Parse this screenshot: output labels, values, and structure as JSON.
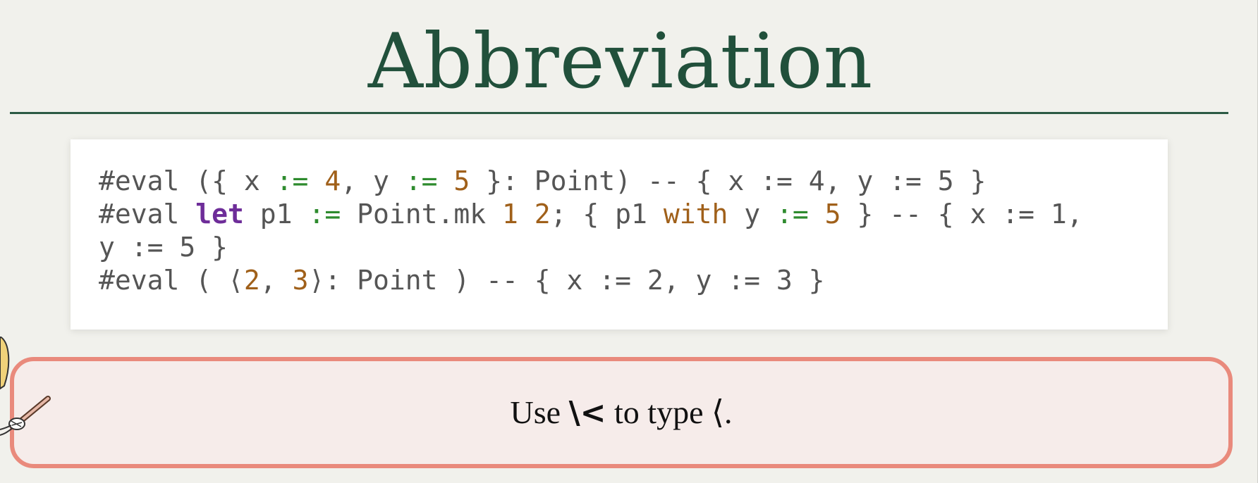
{
  "title": "Abbreviation",
  "code_block": {
    "lines": [
      [
        {
          "t": "#eval ({ x ",
          "c": "plain"
        },
        {
          "t": ":=",
          "c": "op"
        },
        {
          "t": " ",
          "c": "plain"
        },
        {
          "t": "4",
          "c": "num"
        },
        {
          "t": ", y ",
          "c": "plain"
        },
        {
          "t": ":=",
          "c": "op"
        },
        {
          "t": " ",
          "c": "plain"
        },
        {
          "t": "5",
          "c": "num"
        },
        {
          "t": " }: Point) -- { x := 4, y := 5 }",
          "c": "plain"
        }
      ],
      [
        {
          "t": "#eval ",
          "c": "plain"
        },
        {
          "t": "let",
          "c": "kw"
        },
        {
          "t": " p1 ",
          "c": "plain"
        },
        {
          "t": ":=",
          "c": "op"
        },
        {
          "t": " Point.mk ",
          "c": "plain"
        },
        {
          "t": "1",
          "c": "num"
        },
        {
          "t": " ",
          "c": "plain"
        },
        {
          "t": "2",
          "c": "num"
        },
        {
          "t": "; { p1 ",
          "c": "plain"
        },
        {
          "t": "with",
          "c": "with"
        },
        {
          "t": " y ",
          "c": "plain"
        },
        {
          "t": ":=",
          "c": "op"
        },
        {
          "t": " ",
          "c": "plain"
        },
        {
          "t": "5",
          "c": "num"
        },
        {
          "t": " } -- { x := 1,",
          "c": "plain"
        }
      ],
      [
        {
          "t": "y := 5 }",
          "c": "plain"
        }
      ],
      [
        {
          "t": "#eval ( ⟨",
          "c": "plain"
        },
        {
          "t": "2",
          "c": "num"
        },
        {
          "t": ", ",
          "c": "plain"
        },
        {
          "t": "3",
          "c": "num"
        },
        {
          "t": "⟩: Point ) -- { x := 2, y := 3 }",
          "c": "plain"
        }
      ]
    ]
  },
  "tip": {
    "prefix": "Use ",
    "key": "\\<",
    "suffix": " to type ⟨."
  },
  "colors": {
    "title": "#21503b",
    "keyword": "#6e2d99",
    "operator": "#2e8b2e",
    "number": "#a0601a",
    "tip_border": "#e98a7c"
  },
  "icons": {
    "mascot": "pointing-character-icon"
  }
}
